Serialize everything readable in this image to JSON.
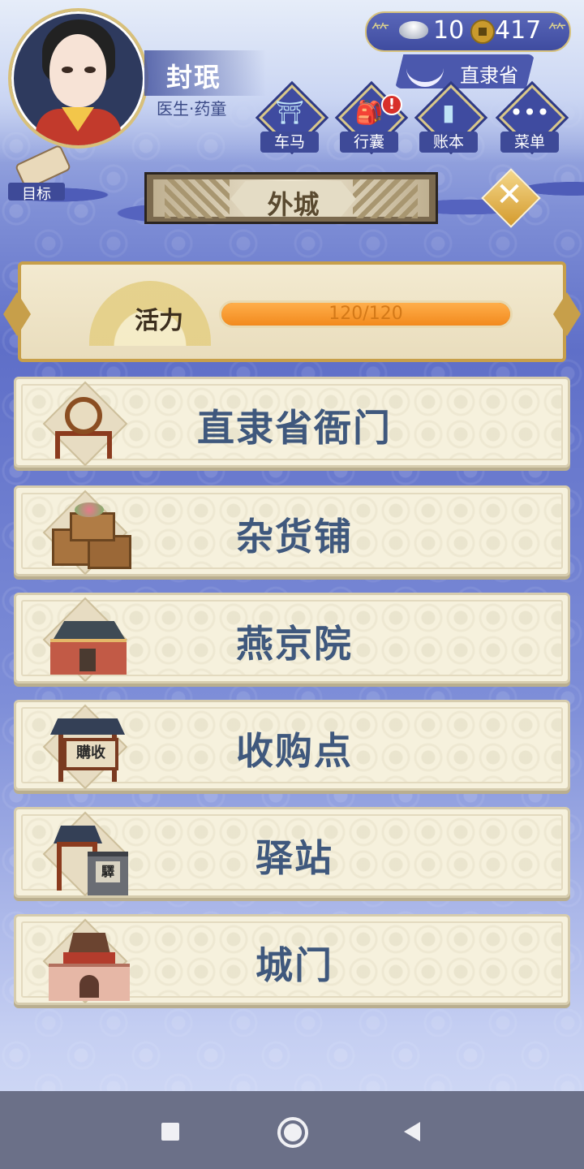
{
  "player": {
    "name": "封珉",
    "title": "医生·药童"
  },
  "currency": {
    "silver_icon": "silver-ingot-icon",
    "silver": "10",
    "coin_icon": "copper-coin-icon",
    "coins": "417"
  },
  "location": {
    "icon": "boat-icon",
    "name": "直隶省"
  },
  "toolbar": [
    {
      "label": "车马",
      "icon": "carriage-icon",
      "alert": false
    },
    {
      "label": "行囊",
      "icon": "bag-icon",
      "alert": true,
      "alert_text": "!"
    },
    {
      "label": "账本",
      "icon": "ledger-icon",
      "alert": false
    },
    {
      "label": "菜单",
      "icon": "menu-dots-icon",
      "alert": false
    }
  ],
  "goal": {
    "label": "目标",
    "icon": "scroll-icon"
  },
  "area": {
    "title": "外城"
  },
  "close": {
    "icon": "close-icon",
    "glyph": "✕"
  },
  "energy": {
    "label": "活力",
    "text": "120/120",
    "current": 120,
    "max": 120,
    "fill_fraction": 1.0
  },
  "destinations": [
    {
      "label": "直隶省衙门",
      "icon": "drum-icon"
    },
    {
      "label": "杂货铺",
      "icon": "crates-icon"
    },
    {
      "label": "燕京院",
      "icon": "palace-icon"
    },
    {
      "label": "收购点",
      "icon": "shop-sign-icon",
      "sign_text": "購收"
    },
    {
      "label": "驿站",
      "icon": "post-station-icon",
      "sign_text": "驛"
    },
    {
      "label": "城门",
      "icon": "city-gate-icon"
    }
  ],
  "colors": {
    "accent_gold": "#d7c27d",
    "menu_text": "#3f587d",
    "energy_fill": "#f28a1e",
    "panel_blue": "#4b58ad"
  }
}
